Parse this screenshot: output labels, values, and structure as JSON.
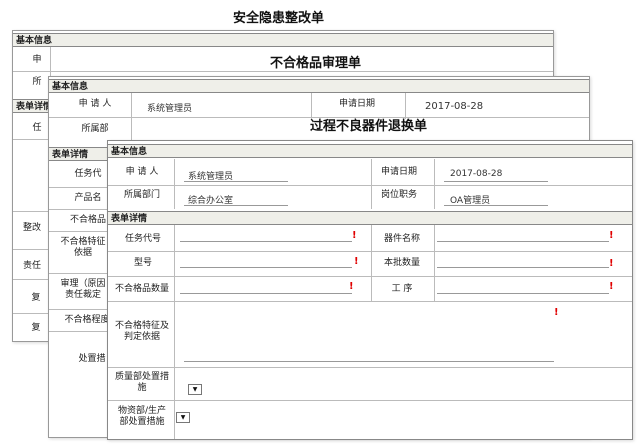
{
  "page1": {
    "title": "安全隐患整改单",
    "section_basic": "基本信息",
    "section_detail": "表单详情",
    "fragments": [
      "申",
      "所",
      "任",
      "整改",
      "责任",
      "复",
      "复"
    ]
  },
  "page2": {
    "title": "不合格品审理单",
    "section_basic": "基本信息",
    "section_detail": "表单详情",
    "applicant_label": "申 请 人",
    "applicant_value": "系统管理员",
    "date_label": "申请日期",
    "date_value": "2017-08-28",
    "dept_label": "所属部",
    "rows": [
      "任务代",
      "产品名",
      "不合格品",
      "不合格特征\n依据",
      "审理（原因\n责任裁定",
      "不合格程度",
      "处置措"
    ]
  },
  "page3": {
    "title": "过程不良器件退换单",
    "section_basic": "基本信息",
    "section_detail": "表单详情",
    "applicant_label": "申 请 人",
    "applicant_value": "系统管理员",
    "date_label": "申请日期",
    "date_value": "2017-08-28",
    "dept_label": "所属部门",
    "dept_value": "综合办公室",
    "position_label": "岗位职务",
    "position_value": "OA管理员",
    "task_code_label": "任务代号",
    "device_name_label": "器件名称",
    "model_label": "型号",
    "batch_qty_label": "本批数量",
    "nonconform_qty_label": "不合格品数量",
    "process_label": "工 序",
    "feature_label": "不合格特征及\n判定依据",
    "quality_label": "质量部处置措\n施",
    "material_label": "物资部/生产\n部处置措施",
    "required_mark": "!",
    "dropdown_glyph": "▼"
  }
}
